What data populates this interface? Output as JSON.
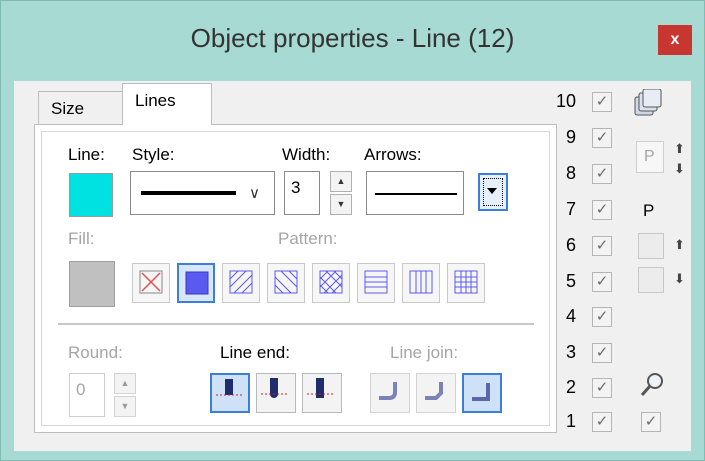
{
  "window": {
    "title": "Object properties - Line (12)",
    "close_glyph": "x"
  },
  "tabs": [
    {
      "label": "Size"
    },
    {
      "label": "Lines"
    }
  ],
  "lines_tab": {
    "line_label": "Line:",
    "style_label": "Style:",
    "width_label": "Width:",
    "arrows_label": "Arrows:",
    "width_value": "3",
    "fill_label": "Fill:",
    "pattern_label": "Pattern:",
    "round_label": "Round:",
    "round_value": "0",
    "line_end_label": "Line end:",
    "line_join_label": "Line join:"
  },
  "colors": {
    "window_bg": "#a6dad3",
    "line_color": "#00e1e1",
    "fill_color": "#c0c0c0",
    "accent": "#3c7fd6",
    "pattern_blue": "#5a5af0",
    "close_red": "#c7372f"
  },
  "patterns": [
    {
      "name": "none-pattern-icon",
      "selected": false
    },
    {
      "name": "solid-pattern-icon",
      "selected": true
    },
    {
      "name": "diagonal-forward-pattern-icon",
      "selected": false
    },
    {
      "name": "diagonal-backward-pattern-icon",
      "selected": false
    },
    {
      "name": "crosshatch-diagonal-pattern-icon",
      "selected": false
    },
    {
      "name": "horizontal-lines-pattern-icon",
      "selected": false
    },
    {
      "name": "vertical-lines-pattern-icon",
      "selected": false
    },
    {
      "name": "grid-pattern-icon",
      "selected": false
    }
  ],
  "line_end_options": [
    {
      "name": "line-end-flat-icon",
      "selected": true
    },
    {
      "name": "line-end-round-icon",
      "selected": false
    },
    {
      "name": "line-end-square-icon",
      "selected": false
    }
  ],
  "line_join_options": [
    {
      "name": "line-join-round-icon",
      "selected": false
    },
    {
      "name": "line-join-bevel-icon",
      "selected": false
    },
    {
      "name": "line-join-miter-icon",
      "selected": true
    }
  ],
  "layers": [
    "10",
    "9",
    "8",
    "7",
    "6",
    "5",
    "4",
    "3",
    "2",
    "1"
  ],
  "side": {
    "p_label": "P",
    "p_label_2": "P",
    "stack_icon": "layers-stack-icon",
    "zoom_icon": "magnifier-icon"
  }
}
